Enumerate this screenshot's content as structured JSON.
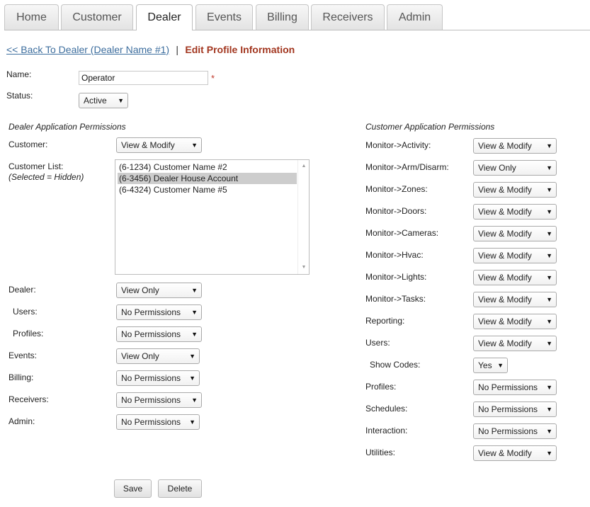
{
  "tabs": [
    {
      "label": "Home"
    },
    {
      "label": "Customer"
    },
    {
      "label": "Dealer"
    },
    {
      "label": "Events"
    },
    {
      "label": "Billing"
    },
    {
      "label": "Receivers"
    },
    {
      "label": "Admin"
    }
  ],
  "active_tab": "Dealer",
  "breadcrumb": {
    "back_link": "<< Back To Dealer (Dealer Name #1)",
    "separator": "|",
    "title": "Edit Profile Information"
  },
  "profile": {
    "name_label": "Name:",
    "name_value": "Operator",
    "required_mark": "*",
    "status_label": "Status:",
    "status_value": "Active"
  },
  "dealer_permissions": {
    "title": "Dealer Application Permissions",
    "customer_label": "Customer:",
    "customer_value": "View & Modify",
    "customer_list_label": "Customer List:",
    "customer_list_note": "(Selected = Hidden)",
    "customer_list": [
      {
        "text": "(6-1234) Customer Name #2",
        "selected": false
      },
      {
        "text": "(6-3456) Dealer House Account",
        "selected": true
      },
      {
        "text": "(6-4324) Customer Name #5",
        "selected": false
      }
    ],
    "rows": [
      {
        "label": "Dealer:",
        "value": "View Only"
      },
      {
        "label": "Users:",
        "value": "No Permissions"
      },
      {
        "label": "Profiles:",
        "value": "No Permissions"
      },
      {
        "label": "Events:",
        "value": "View Only"
      },
      {
        "label": "Billing:",
        "value": "No Permissions"
      },
      {
        "label": "Receivers:",
        "value": "No Permissions"
      },
      {
        "label": "Admin:",
        "value": "No Permissions"
      }
    ]
  },
  "customer_permissions": {
    "title": "Customer Application Permissions",
    "rows": [
      {
        "label": "Monitor->Activity:",
        "value": "View & Modify"
      },
      {
        "label": "Monitor->Arm/Disarm:",
        "value": "View Only"
      },
      {
        "label": "Monitor->Zones:",
        "value": "View & Modify"
      },
      {
        "label": "Monitor->Doors:",
        "value": "View & Modify"
      },
      {
        "label": "Monitor->Cameras:",
        "value": "View & Modify"
      },
      {
        "label": "Monitor->Hvac:",
        "value": "View & Modify"
      },
      {
        "label": "Monitor->Lights:",
        "value": "View & Modify"
      },
      {
        "label": "Monitor->Tasks:",
        "value": "View & Modify"
      },
      {
        "label": "Reporting:",
        "value": "View & Modify"
      },
      {
        "label": "Users:",
        "value": "View & Modify"
      },
      {
        "label": "Show Codes:",
        "value": "Yes"
      },
      {
        "label": "Profiles:",
        "value": "No Permissions"
      },
      {
        "label": "Schedules:",
        "value": "No Permissions"
      },
      {
        "label": "Interaction:",
        "value": "No Permissions"
      },
      {
        "label": "Utilities:",
        "value": "View & Modify"
      }
    ]
  },
  "actions": {
    "save_label": "Save",
    "delete_label": "Delete"
  },
  "icons": {
    "dropdown_arrow": "chevron-down-icon",
    "scroll_up": "scroll-up-icon",
    "scroll_down": "scroll-down-icon"
  }
}
